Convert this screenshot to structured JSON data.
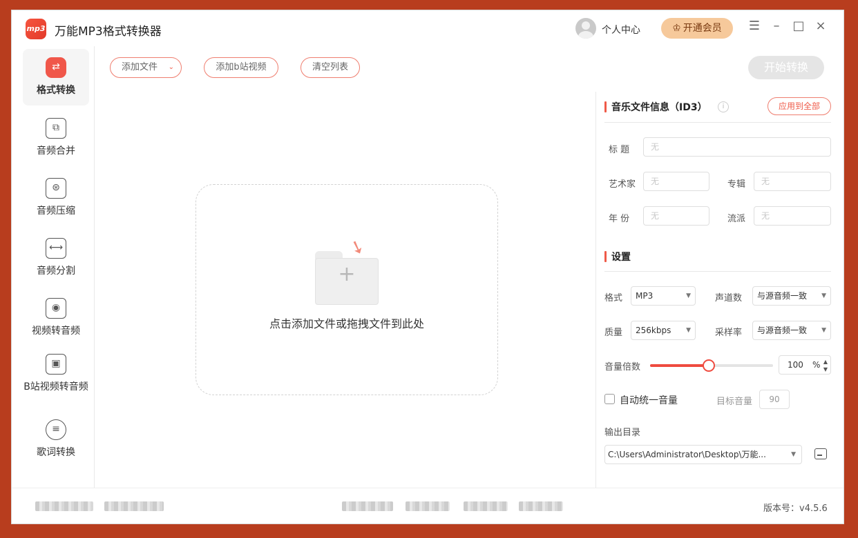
{
  "app": {
    "logo_text": "mp3",
    "title": "万能MP3格式转换器",
    "user_center": "个人中心",
    "vip_label": "开通会员",
    "version": "版本号：v4.5.6"
  },
  "icons": {
    "menu": "☰",
    "minimize": "–",
    "maximize": "□",
    "close": "×"
  },
  "sidebar": {
    "items": [
      {
        "label": "格式转换",
        "icon": "format-convert-icon",
        "glyph": "⇄",
        "active": true
      },
      {
        "label": "音频合并",
        "icon": "audio-merge-icon",
        "glyph": "⧉"
      },
      {
        "label": "音频压缩",
        "icon": "audio-compress-icon",
        "glyph": "⊛"
      },
      {
        "label": "音频分割",
        "icon": "audio-split-icon",
        "glyph": "⟷"
      },
      {
        "label": "视频转音频",
        "icon": "video-to-audio-icon",
        "glyph": "◉"
      },
      {
        "label": "B站视频转音频",
        "icon": "bilibili-icon",
        "glyph": "▣"
      },
      {
        "label": "歌词转换",
        "icon": "lyrics-icon",
        "glyph": "≡"
      }
    ]
  },
  "toolbar": {
    "add_file": "添加文件",
    "add_bilibili": "添加b站视频",
    "clear_list": "清空列表",
    "start": "开始转换"
  },
  "dropzone": {
    "text": "点击添加文件或拖拽文件到此处"
  },
  "id3": {
    "title": "音乐文件信息（ID3）",
    "apply_all": "应用到全部",
    "fields": {
      "title_label": "标  题",
      "artist_label": "艺术家",
      "album_label": "专辑",
      "year_label": "年  份",
      "genre_label": "流派",
      "placeholder": "无"
    }
  },
  "settings": {
    "title": "设置",
    "format_label": "格式",
    "format_value": "MP3",
    "channels_label": "声道数",
    "channels_value": "与源音频一致",
    "quality_label": "质量",
    "quality_value": "256kbps",
    "sample_rate_label": "采样率",
    "sample_rate_value": "与源音频一致",
    "volume_label": "音量倍数",
    "volume_value": "100",
    "volume_unit": "%",
    "volume_fraction": 0.48,
    "auto_normalize_label": "自动统一音量",
    "target_volume_label": "目标音量",
    "target_volume_value": "90",
    "output_dir_label": "输出目录",
    "output_dir_value": "C:\\Users\\Administrator\\Desktop\\万能..."
  },
  "colors": {
    "accent": "#ef5a48",
    "frame": "#b83d1e",
    "vip": "#f6c99b"
  }
}
